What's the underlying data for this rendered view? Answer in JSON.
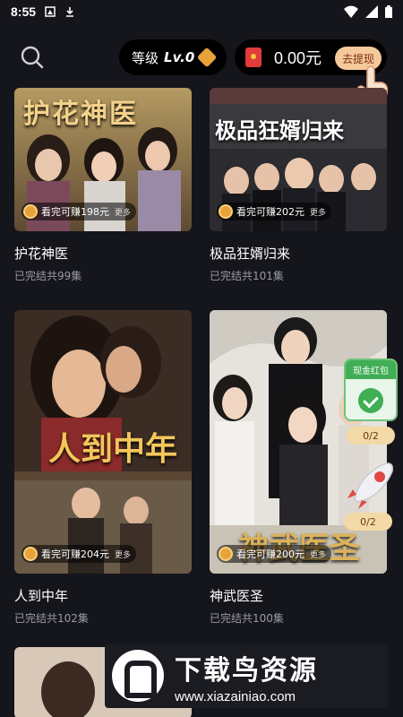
{
  "status_bar": {
    "time": "8:55"
  },
  "header": {
    "level_label": "等级",
    "level_value": "Lv.0",
    "balance": "0.00元",
    "withdraw_label": "去提现"
  },
  "dramas": [
    {
      "poster_title": "护花神医",
      "reward_text": "看完可赚198元",
      "more": "更多",
      "name": "护花神医",
      "status": "已完结共99集"
    },
    {
      "poster_title": "极品狂婿归来",
      "reward_text": "看完可赚202元",
      "more": "更多",
      "name": "极品狂婿归来",
      "status": "已完结共101集"
    },
    {
      "poster_title": "人到中年",
      "reward_text": "看完可赚204元",
      "more": "更多",
      "name": "人到中年",
      "status": "已完结共102集"
    },
    {
      "poster_title": "神武医圣",
      "reward_text": "看完可赚200元",
      "more": "更多",
      "name": "神武医圣",
      "status": "已完结共100集"
    }
  ],
  "side_widget": {
    "redpack_title": "现金红包",
    "redpack_progress": "0/2",
    "rocket_progress": "0/2"
  },
  "watermark": {
    "title": "下载鸟资源",
    "url": "www.xiazainiao.com"
  },
  "colors": {
    "background": "#15151c",
    "accent_gold": "#e8a23a",
    "cash_green": "#3fae55",
    "red_envelope": "#e23b3b"
  },
  "icons": [
    "search-icon",
    "gem-icon",
    "red-envelope-icon",
    "hand-pointer-icon",
    "coin-icon",
    "check-icon",
    "rocket-icon"
  ]
}
